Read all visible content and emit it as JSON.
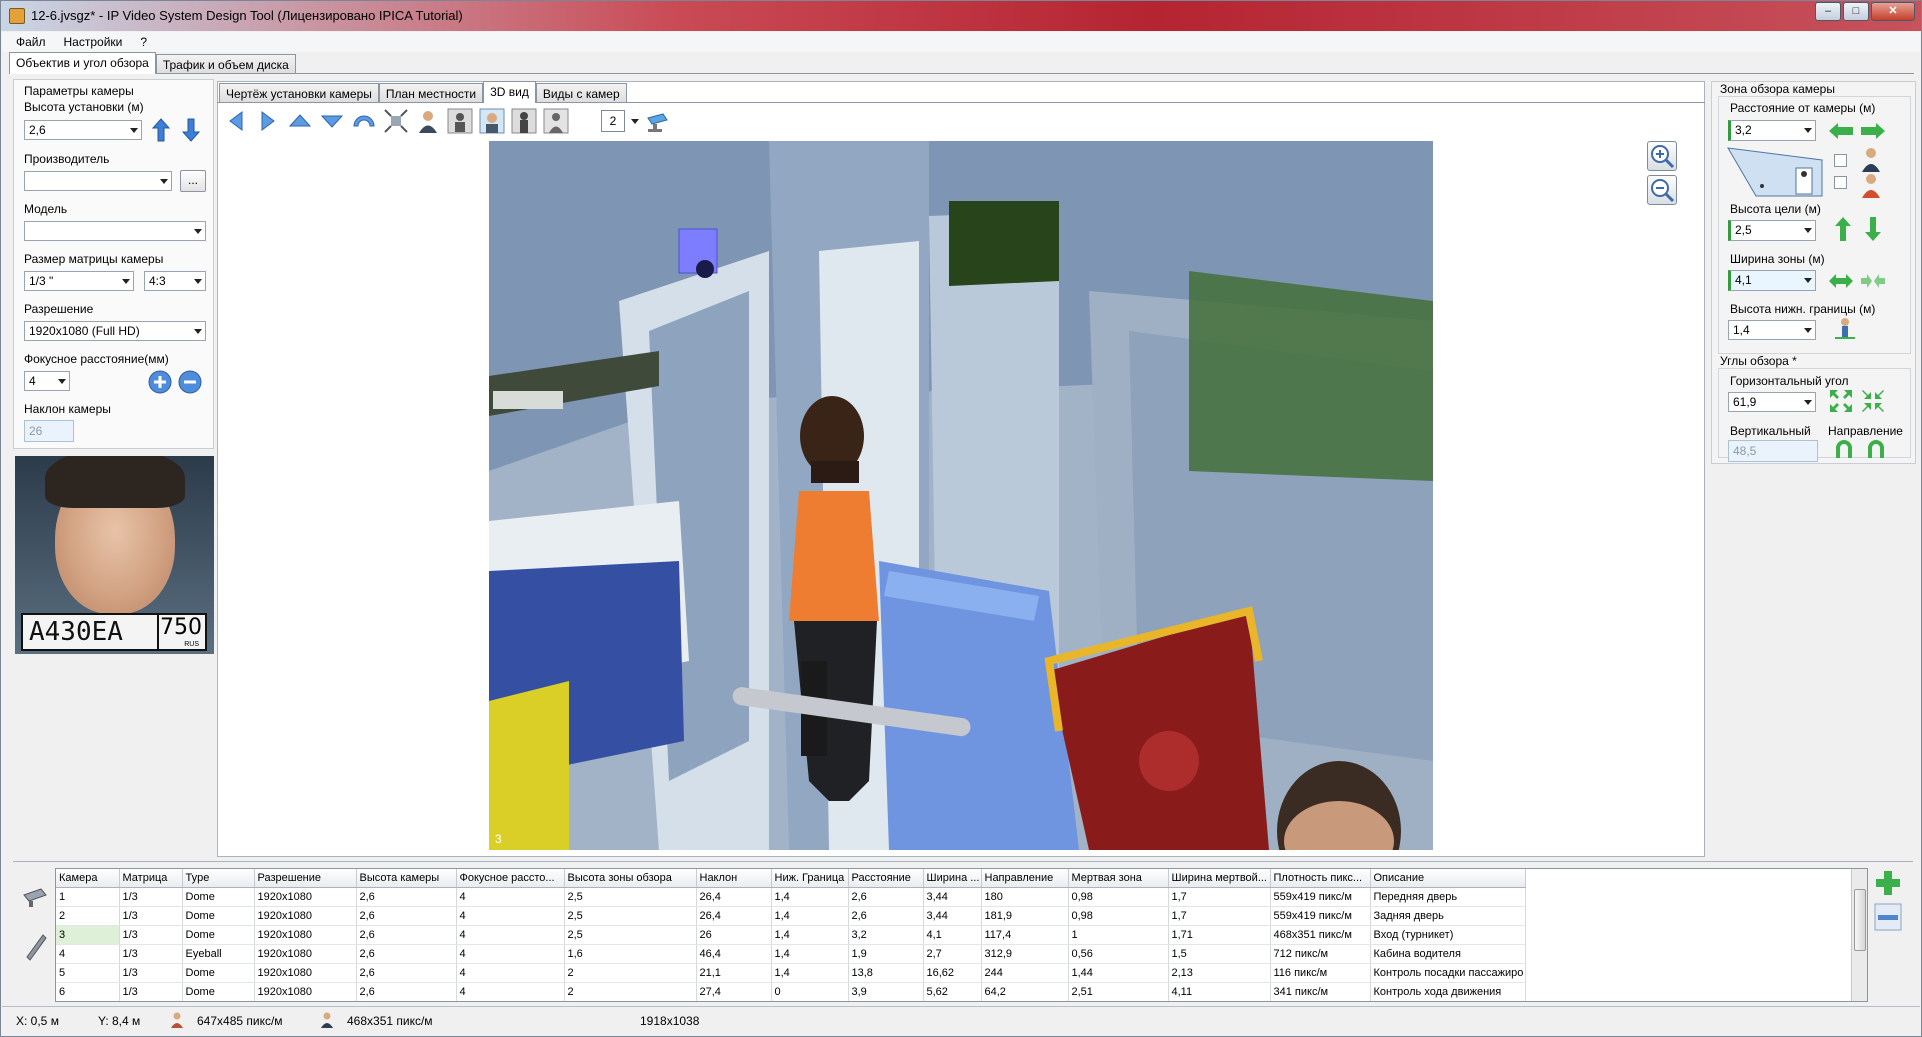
{
  "window": {
    "title": "12-6.jvsgz* - IP Video System Design Tool (Лицензировано  IPICA Tutorial)",
    "minimize": "–",
    "maximize": "□",
    "close": "✕"
  },
  "menu": [
    "Файл",
    "Настройки",
    "?"
  ],
  "top_tabs": [
    "Объектив и угол обзора",
    "Трафик и объем диска"
  ],
  "left": {
    "section": "Параметры камеры",
    "height_label": "Высота установки (м)",
    "height_value": "2,6",
    "manufacturer_label": "Производитель",
    "manufacturer_value": "",
    "manufacturer_btn": "...",
    "model_label": "Модель",
    "model_value": "",
    "sensor_label": "Размер матрицы камеры",
    "sensor_value": "1/3 \"",
    "aspect_value": "4:3",
    "resolution_label": "Разрешение",
    "resolution_value": "1920x1080 (Full HD)",
    "focal_label": "Фокусное расстояние(мм)",
    "focal_value": "4",
    "tilt_label": "Наклон камеры",
    "tilt_value": "26",
    "plate_number": "A430EA",
    "plate_region": "750",
    "plate_country": "RUS"
  },
  "view_tabs": [
    "Чертёж установки камеры",
    "План местности",
    "3D вид",
    "Виды с камер"
  ],
  "view_toolbar": {
    "camera_number": "2"
  },
  "view_label": "3",
  "right": {
    "zone_title": "Зона обзора камеры",
    "distance_label": "Расстояние от камеры (м)",
    "distance_value": "3,2",
    "target_height_label": "Высота цели (м)",
    "target_height_value": "2,5",
    "zone_width_label": "Ширина зоны (м)",
    "zone_width_value": "4,1",
    "lower_border_label": "Высота нижн. границы (м)",
    "lower_border_value": "1,4",
    "angles_title": "Углы обзора *",
    "horizontal_label": "Горизонтальный угол",
    "horizontal_value": "61,9",
    "vertical_label": "Вертикальный",
    "vertical_value": "48,5",
    "direction_label": "Направление"
  },
  "table": {
    "columns": [
      "Камера",
      "Матрица",
      "Type",
      "Разрешение",
      "Высота камеры",
      "Фокусное рассто...",
      "Высота зоны обзора",
      "Наклон",
      "Ниж. Граница",
      "Расстояние",
      "Ширина ...",
      "Направление",
      "Мертвая зона",
      "Ширина мертвой...",
      "Плотность пикс...",
      "Описание"
    ],
    "rows": [
      [
        "1",
        "1/3",
        "Dome",
        "1920x1080",
        "2,6",
        "4",
        "2,5",
        "26,4",
        "1,4",
        "2,6",
        "3,44",
        "180",
        "0,98",
        "1,7",
        "559x419 пикс/м",
        "Передняя дверь"
      ],
      [
        "2",
        "1/3",
        "Dome",
        "1920x1080",
        "2,6",
        "4",
        "2,5",
        "26,4",
        "1,4",
        "2,6",
        "3,44",
        "181,9",
        "0,98",
        "1,7",
        "559x419 пикс/м",
        "Задняя дверь"
      ],
      [
        "3",
        "1/3",
        "Dome",
        "1920x1080",
        "2,6",
        "4",
        "2,5",
        "26",
        "1,4",
        "3,2",
        "4,1",
        "117,4",
        "1",
        "1,71",
        "468x351 пикс/м",
        "Вход (турникет)"
      ],
      [
        "4",
        "1/3",
        "Eyeball",
        "1920x1080",
        "2,6",
        "4",
        "1,6",
        "46,4",
        "1,4",
        "1,9",
        "2,7",
        "312,9",
        "0,56",
        "1,5",
        "712 пикс/м",
        "Кабина водителя"
      ],
      [
        "5",
        "1/3",
        "Dome",
        "1920x1080",
        "2,6",
        "4",
        "2",
        "21,1",
        "1,4",
        "13,8",
        "16,62",
        "244",
        "1,44",
        "2,13",
        "116 пикс/м",
        "Контроль посадки пассажиро"
      ],
      [
        "6",
        "1/3",
        "Dome",
        "1920x1080",
        "2,6",
        "4",
        "2",
        "27,4",
        "0",
        "3,9",
        "5,62",
        "64,2",
        "2,51",
        "4,11",
        "341 пикс/м",
        "Контроль хода движения"
      ]
    ]
  },
  "status": {
    "x": "X: 0,5 м",
    "y": "Y: 8,4 м",
    "density1": "647x485 пикс/м",
    "density2": "468x351 пикс/м",
    "size": "1918x1038"
  },
  "colors": {
    "accent_green": "#2f9e3a",
    "arrow_blue": "#3d7fd6",
    "title_red": "#b52431"
  }
}
